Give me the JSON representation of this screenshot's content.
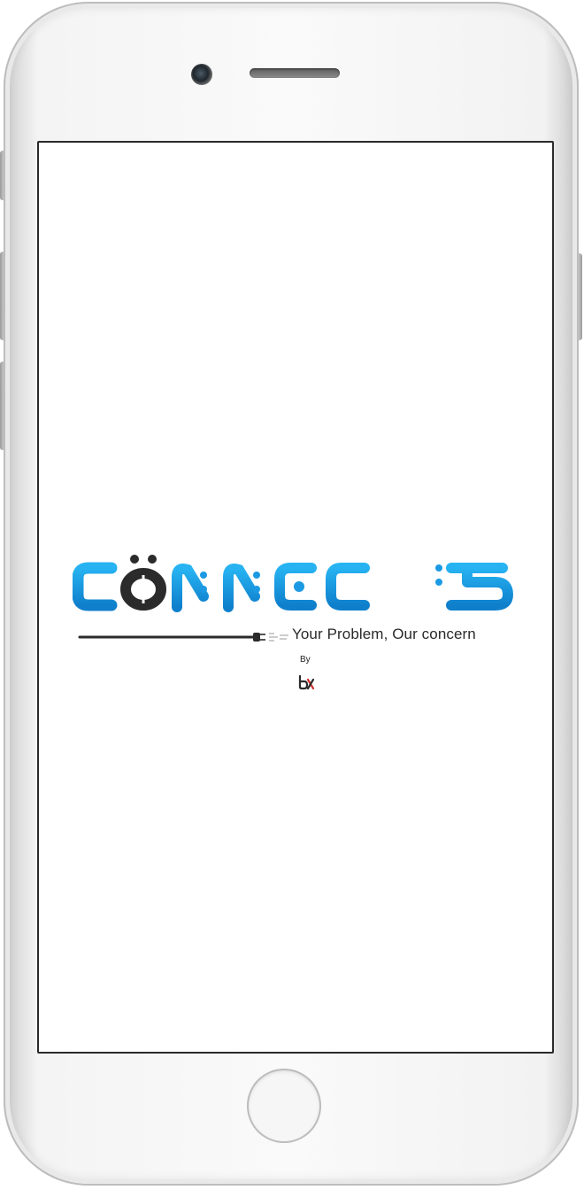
{
  "splash": {
    "logo_text": "CONNECTS",
    "tagline": "Your Problem, Our concern",
    "by_label": "By",
    "maker_logo": "bt-logo-icon"
  },
  "colors": {
    "brand_blue": "#1b9ae3",
    "brand_dark": "#2b2b2b",
    "accent_red": "#d32f2f",
    "screen_bg": "#ffffff",
    "device_frame": "#f4f4f4"
  }
}
